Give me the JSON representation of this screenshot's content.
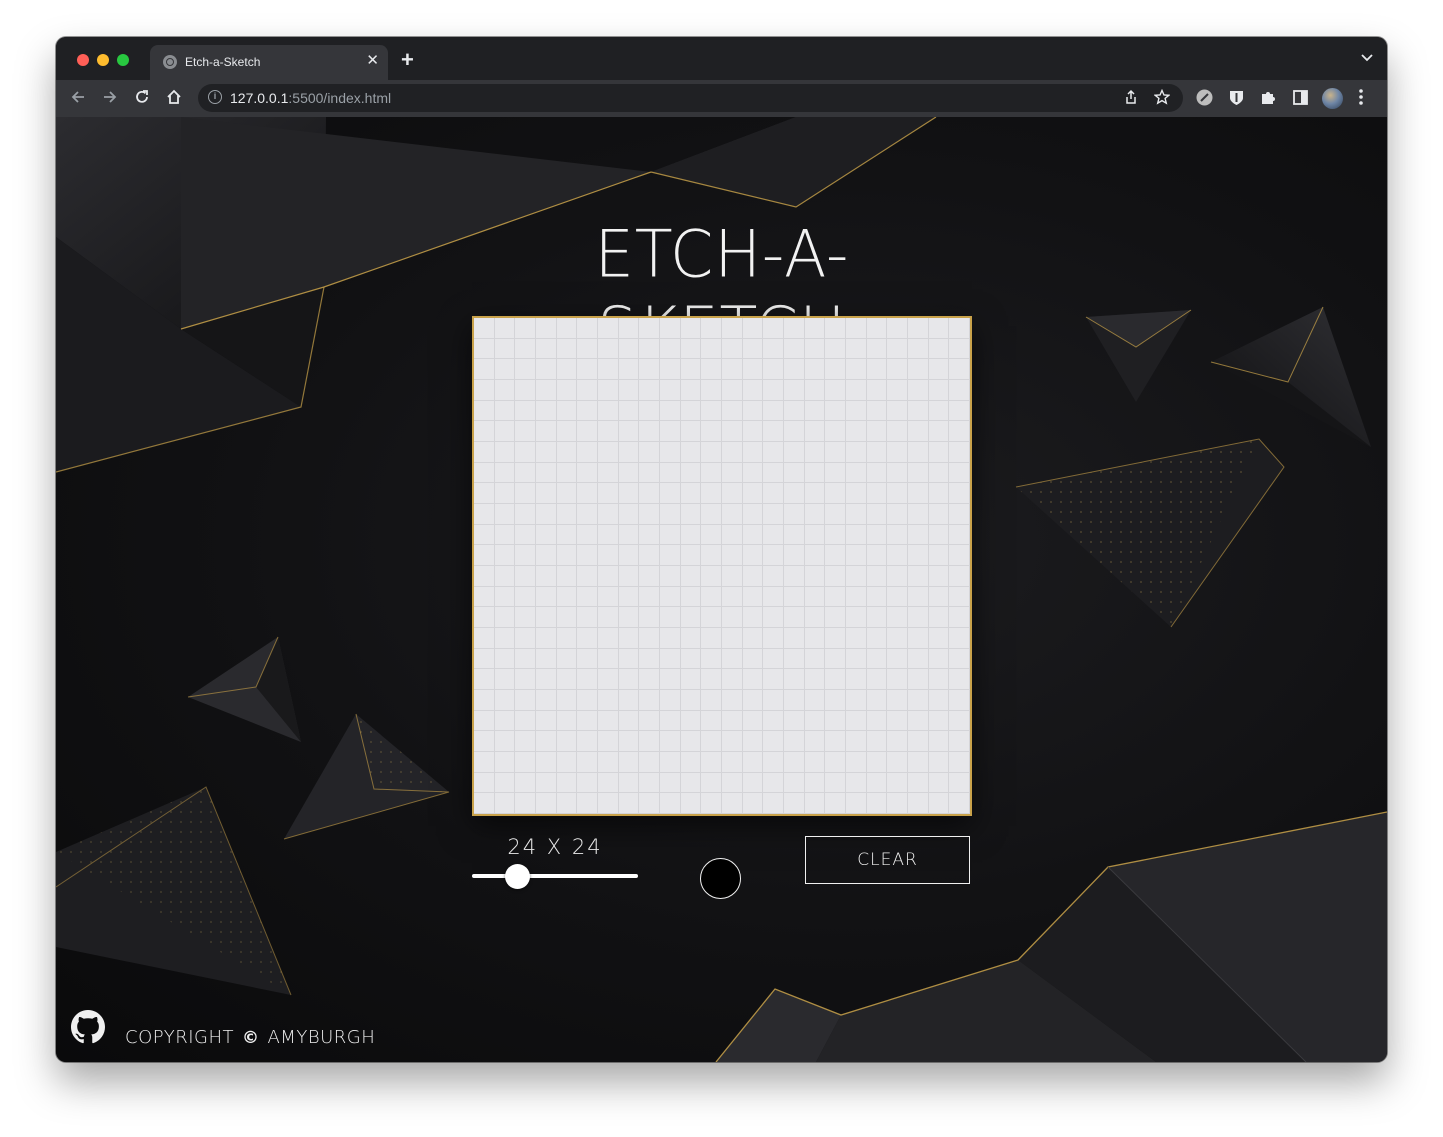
{
  "browser": {
    "tab_title": "Etch-a-Sketch",
    "tab_close": "✕",
    "new_tab": "+",
    "tab_menu": "⌄",
    "url_host": "127.0.0.1",
    "url_path": ":5500/index.html",
    "icons": [
      "back-icon",
      "forward-icon",
      "reload-icon",
      "home-icon",
      "info-icon",
      "share-icon",
      "star-icon",
      "extension-icon",
      "shield-icon",
      "puzzle-icon",
      "sidebar-icon",
      "avatar",
      "kebab-menu-icon"
    ]
  },
  "page": {
    "title": "ETCH-A-SKETCH",
    "grid": {
      "rows": 24,
      "columns": 24
    },
    "size_label": "24 X 24",
    "slider": {
      "min": 1,
      "max": 100,
      "value": 24
    },
    "pen_color": "#000000",
    "clear_label": "CLEAR",
    "footer": {
      "copyright_word": "COPYRIGHT",
      "copyright_symbol": "©",
      "author": "AMYBURGH"
    },
    "accent_color": "#c9a24a"
  }
}
